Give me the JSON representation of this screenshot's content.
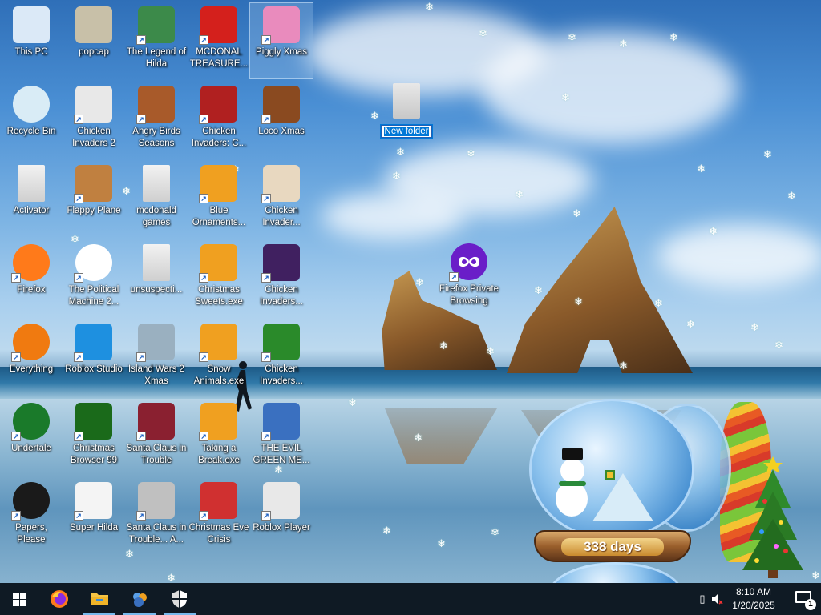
{
  "desktop": {
    "icons": [
      {
        "label": "This PC",
        "icon": "computer-icon",
        "color": "#dbe9f7"
      },
      {
        "label": "popcap",
        "icon": "popcap-folder-icon",
        "color": "#c8c0a8"
      },
      {
        "label": "The Legend of Hilda",
        "icon": "hilda-game-icon",
        "color": "#3c8a4a"
      },
      {
        "label": "MCDONAL TREASURE...",
        "icon": "mcdonalds-icon",
        "color": "#d4201c"
      },
      {
        "label": "Piggly Xmas",
        "icon": "piggly-xmas-icon",
        "color": "#e98bbd"
      },
      {
        "label": "Recycle Bin",
        "icon": "recycle-bin-icon",
        "color": "#d9ecf6"
      },
      {
        "label": "Chicken Invaders 2",
        "icon": "chicken-invaders-2-icon",
        "color": "#e8e8e8"
      },
      {
        "label": "Angry Birds Seasons",
        "icon": "angry-birds-icon",
        "color": "#a85a2a"
      },
      {
        "label": "Chicken Invaders: C...",
        "icon": "chicken-invaders-c-icon",
        "color": "#b02020"
      },
      {
        "label": "Loco Xmas",
        "icon": "loco-xmas-icon",
        "color": "#8a4a20"
      },
      {
        "label": "Activator",
        "icon": "activator-icon",
        "color": "#e4e4e4"
      },
      {
        "label": "Flappy Plane",
        "icon": "flappy-plane-icon",
        "color": "#c08040"
      },
      {
        "label": "mcdonald games",
        "icon": "folder-icon",
        "color": "#e4e4e4"
      },
      {
        "label": "Blue Ornaments...",
        "icon": "ornaments-exe-icon",
        "color": "#f0a020"
      },
      {
        "label": "Chicken Invader...",
        "icon": "chicken-invaders-xmas-icon",
        "color": "#e8d8c0"
      },
      {
        "label": "Firefox",
        "icon": "firefox-icon",
        "color": "#ff7a1a"
      },
      {
        "label": "The Political Machine 2...",
        "icon": "political-machine-icon",
        "color": "#ffffff"
      },
      {
        "label": "unsuspecti...",
        "icon": "folder-icon",
        "color": "#e4e4e4"
      },
      {
        "label": "Christmas Sweets.exe",
        "icon": "sweets-exe-icon",
        "color": "#f0a020"
      },
      {
        "label": "Chicken Invaders...",
        "icon": "chicken-invaders-4-icon",
        "color": "#402060"
      },
      {
        "label": "Everything",
        "icon": "everything-search-icon",
        "color": "#f07a10"
      },
      {
        "label": "Roblox Studio",
        "icon": "roblox-studio-icon",
        "color": "#1e90e0"
      },
      {
        "label": "Island Wars 2 Xmas",
        "icon": "island-wars-icon",
        "color": "#9ab0c0"
      },
      {
        "label": "Snow Animals.exe",
        "icon": "snow-animals-exe-icon",
        "color": "#f0a020"
      },
      {
        "label": "Chicken Invaders...",
        "icon": "chicken-invaders-5-icon",
        "color": "#2a8a2a"
      },
      {
        "label": "Undertale",
        "icon": "undertale-icon",
        "color": "#1a7a2a"
      },
      {
        "label": "Christmas Browser 99",
        "icon": "christmas-tree-icon",
        "color": "#1a6a1a"
      },
      {
        "label": "Santa Claus in Trouble",
        "icon": "santa-trouble-icon",
        "color": "#8a2030"
      },
      {
        "label": "Taking a Break.exe",
        "icon": "taking-break-exe-icon",
        "color": "#f0a020"
      },
      {
        "label": "THE EVIL GREEN ME...",
        "icon": "evil-green-icon",
        "color": "#3a70c0"
      },
      {
        "label": "Papers, Please",
        "icon": "papers-please-icon",
        "color": "#1a1a1a"
      },
      {
        "label": "Super Hilda",
        "icon": "super-hilda-icon",
        "color": "#f4f4f4"
      },
      {
        "label": "Santa Claus in Trouble... A...",
        "icon": "santa-trouble-2-icon",
        "color": "#c0c0c0"
      },
      {
        "label": "Christmas Eve Crisis",
        "icon": "christmas-eve-crisis-icon",
        "color": "#d03030"
      },
      {
        "label": "Roblox Player",
        "icon": "roblox-player-icon",
        "color": "#e8e8e8"
      }
    ],
    "new_folder": {
      "label": "New folder",
      "icon": "folder-icon"
    },
    "firefox_private": {
      "label": "Firefox Private Browsing",
      "icon": "firefox-private-icon",
      "color": "#6a1ec8"
    }
  },
  "widget": {
    "days_text": "338 days",
    "icon": "snow-globe-icon"
  },
  "taskbar": {
    "pinned": [
      {
        "name": "taskbar-start-button",
        "icon": "windows-logo-icon"
      },
      {
        "name": "taskbar-firefox",
        "icon": "firefox-icon"
      },
      {
        "name": "taskbar-file-explorer",
        "icon": "folder-icon"
      },
      {
        "name": "taskbar-evil-green-me",
        "icon": "evil-green-icon"
      },
      {
        "name": "taskbar-security",
        "icon": "shield-icon"
      }
    ],
    "time": "8:10 AM",
    "date": "1/20/2025",
    "notification_count": "1"
  },
  "colors": {
    "taskbar_bg": "#0f1a24",
    "accent": "#0078d7",
    "active_underline": "#76b9ed"
  }
}
